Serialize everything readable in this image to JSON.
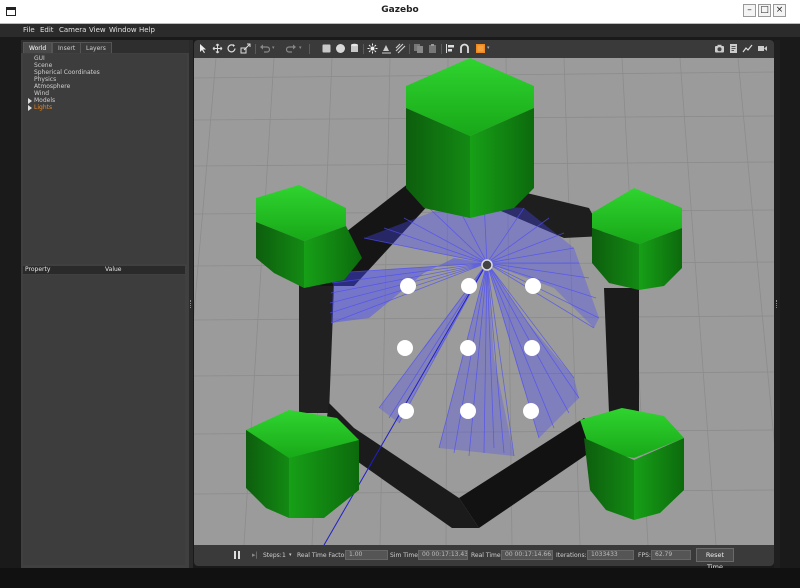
{
  "window": {
    "title": "Gazebo"
  },
  "menu": [
    "File",
    "Edit",
    "Camera",
    "View",
    "Window",
    "Help"
  ],
  "tabs": [
    "World",
    "Insert",
    "Layers"
  ],
  "tree": {
    "items": [
      "GUI",
      "Scene",
      "Spherical Coordinates",
      "Physics",
      "Atmosphere",
      "Wind"
    ],
    "models": "Models",
    "lights": "Lights"
  },
  "properties": {
    "col_property": "Property",
    "col_value": "Value"
  },
  "toolbar": {
    "icons": [
      "select-arrow-icon",
      "translate-icon",
      "rotate-icon",
      "scale-icon",
      "undo-icon",
      "redo-icon",
      "box-icon",
      "sphere-icon",
      "cylinder-icon",
      "point-light-icon",
      "spot-light-icon",
      "directional-light-icon",
      "copy-icon",
      "paste-icon",
      "align-icon",
      "snap-icon",
      "change-view-icon",
      "screenshot-icon",
      "log-icon",
      "plot-icon",
      "record-video-icon"
    ],
    "accent": "#ef8a1e"
  },
  "status": {
    "steps_label": "Steps:",
    "steps_value": "1",
    "rtf_label": "Real Time Factor:",
    "rtf_value": "1.00",
    "sim_time_label": "Sim Time:",
    "sim_time_value": "00 00:17:13.433",
    "real_time_label": "Real Time:",
    "real_time_value": "00 00:17:14.661",
    "iterations_label": "Iterations:",
    "iterations_value": "1033433",
    "fps_label": "FPS:",
    "fps_value": "62.79",
    "reset_label": "Reset Time"
  },
  "scene": {
    "colors": {
      "ground": "#9b9b9b",
      "hexagon": "#1e1e1e",
      "cube": "#1ea01e",
      "laser": "#4a4aff",
      "cylinders": "#ffffff"
    }
  }
}
